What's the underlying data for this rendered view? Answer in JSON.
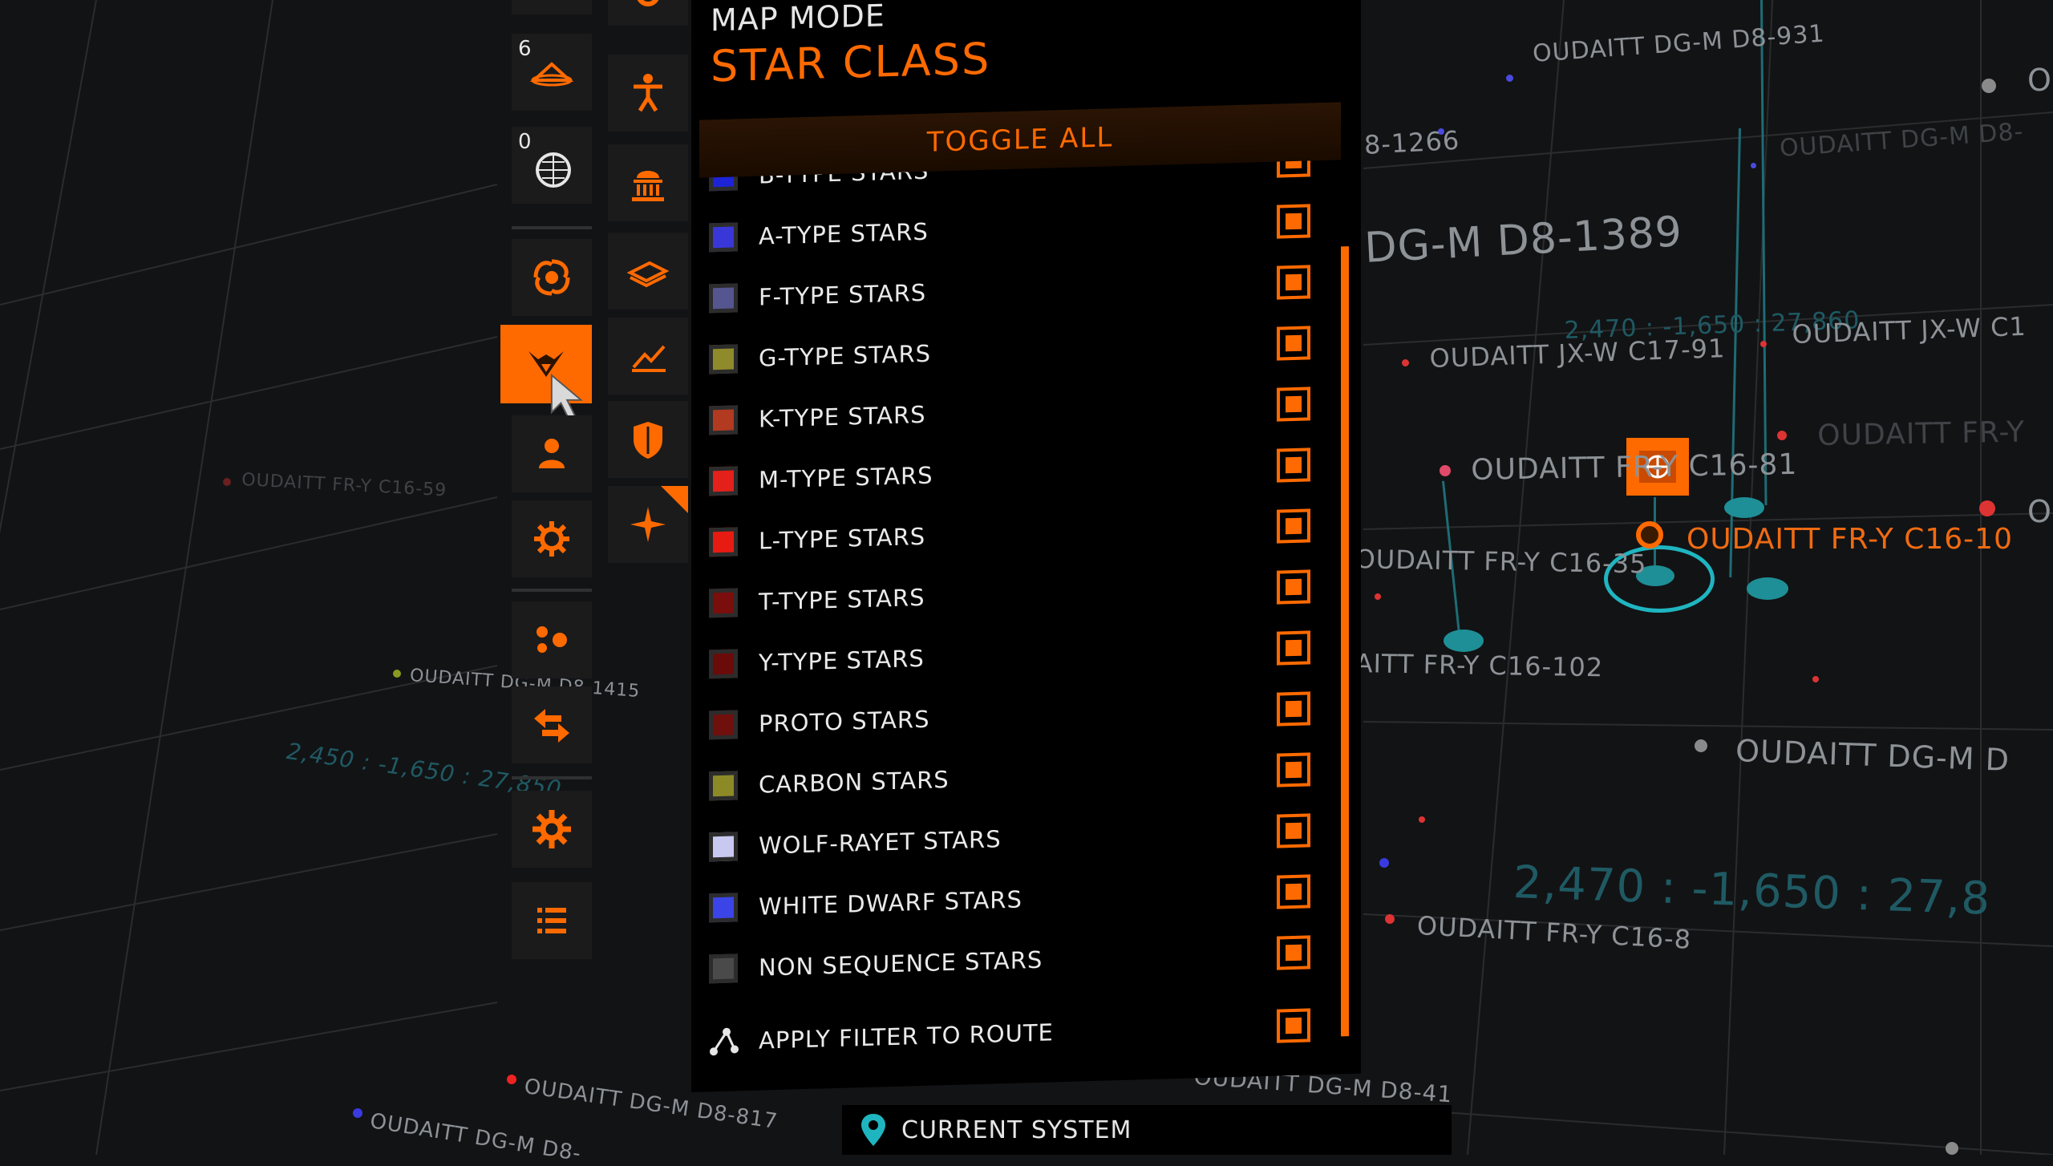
{
  "map_labels": [
    {
      "text": "OUDAITT DG-M D8-931",
      "style": "normal"
    },
    {
      "text": "OUDAITT DG-M D8-",
      "style": "dim"
    },
    {
      "text": "8-1266",
      "style": "normal"
    },
    {
      "text": "DG-M D8-1389",
      "style": "normal"
    },
    {
      "text": "2,470 : -1,650 : 27,860",
      "style": "cyan"
    },
    {
      "text": "OUDAITT JX-W C17-91",
      "style": "normal"
    },
    {
      "text": "OUDAITT JX-W C1",
      "style": "normal"
    },
    {
      "text": "OUDAITT FR-Y",
      "style": "dim"
    },
    {
      "text": "OUDAITT FR-Y C16-81",
      "style": "normal"
    },
    {
      "text": "OUDAITT FR-Y C16-10",
      "style": "orange"
    },
    {
      "text": "OUDAITT FR-Y C16-35",
      "style": "normal"
    },
    {
      "text": "AITT FR-Y C16-102",
      "style": "normal"
    },
    {
      "text": "OUDAITT DG-M D",
      "style": "normal"
    },
    {
      "text": "2,470 : -1,650 : 27,8",
      "style": "cyan"
    },
    {
      "text": "OUDAITT FR-Y C16-8",
      "style": "normal"
    },
    {
      "text": "OUDAITT DG-M D8-41",
      "style": "normal"
    },
    {
      "text": "OUDAITT FR-Y C16-59",
      "style": "dim"
    },
    {
      "text": "OUDAITT DG-M D8-1415",
      "style": "normal"
    },
    {
      "text": "2,450 : -1,650 : 27,850",
      "style": "cyan"
    },
    {
      "text": "OUDAITT DG-M D8-817",
      "style": "normal"
    },
    {
      "text": "OUDAITT DG-M D8-",
      "style": "normal"
    },
    {
      "text": "O",
      "style": "normal"
    },
    {
      "text": "O",
      "style": "normal"
    }
  ],
  "left_bar": {
    "counts": [
      "6",
      "0"
    ]
  },
  "panel": {
    "title": "MAP MODE",
    "subtitle": "STAR CLASS",
    "toggle_all": "TOGGLE ALL",
    "filters": [
      {
        "label": "B-TYPE STARS",
        "color": "#1d24d6",
        "checked": true
      },
      {
        "label": "A-TYPE STARS",
        "color": "#3a37d8",
        "checked": true
      },
      {
        "label": "F-TYPE STARS",
        "color": "#55568f",
        "checked": true
      },
      {
        "label": "G-TYPE STARS",
        "color": "#8f8a2a",
        "checked": true
      },
      {
        "label": "K-TYPE STARS",
        "color": "#b13a21",
        "checked": true
      },
      {
        "label": "M-TYPE STARS",
        "color": "#e3201a",
        "checked": true
      },
      {
        "label": "L-TYPE STARS",
        "color": "#e81b13",
        "checked": true
      },
      {
        "label": "T-TYPE STARS",
        "color": "#7a0e0c",
        "checked": true
      },
      {
        "label": "Y-TYPE STARS",
        "color": "#6a0b0a",
        "checked": true
      },
      {
        "label": "PROTO STARS",
        "color": "#70100d",
        "checked": true
      },
      {
        "label": "CARBON STARS",
        "color": "#8c8a26",
        "checked": true
      },
      {
        "label": "WOLF-RAYET STARS",
        "color": "#c9c8f0",
        "checked": true
      },
      {
        "label": "WHITE DWARF STARS",
        "color": "#3b44e6",
        "checked": true
      },
      {
        "label": "NON SEQUENCE STARS",
        "color": "#4a4a4a",
        "checked": true
      }
    ],
    "apply_filter": "APPLY FILTER TO ROUTE"
  },
  "bottom": {
    "current_system": "CURRENT SYSTEM"
  },
  "colors": {
    "accent": "#ff6a00",
    "cyan": "#1fb5c0",
    "panel_bg": "#000000"
  }
}
